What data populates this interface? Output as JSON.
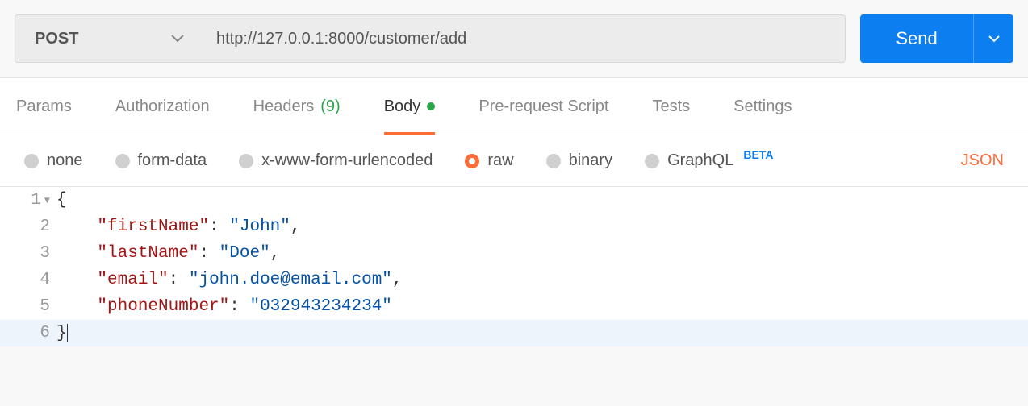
{
  "request": {
    "method": "POST",
    "url": "http://127.0.0.1:8000/customer/add",
    "send_label": "Send"
  },
  "tabs": {
    "params": "Params",
    "authorization": "Authorization",
    "headers": "Headers",
    "headers_count": "(9)",
    "body": "Body",
    "prerequest": "Pre-request Script",
    "tests": "Tests",
    "settings": "Settings"
  },
  "body_types": {
    "none": "none",
    "form_data": "form-data",
    "urlencoded": "x-www-form-urlencoded",
    "raw": "raw",
    "binary": "binary",
    "graphql": "GraphQL",
    "beta": "BETA"
  },
  "lang": "JSON",
  "editor": {
    "lines": [
      "1",
      "2",
      "3",
      "4",
      "5",
      "6"
    ],
    "keys": {
      "firstName": "\"firstName\"",
      "lastName": "\"lastName\"",
      "email": "\"email\"",
      "phoneNumber": "\"phoneNumber\""
    },
    "values": {
      "firstName": "\"John\"",
      "lastName": "\"Doe\"",
      "email": "\"john.doe@email.com\"",
      "phoneNumber": "\"032943234234\""
    }
  }
}
